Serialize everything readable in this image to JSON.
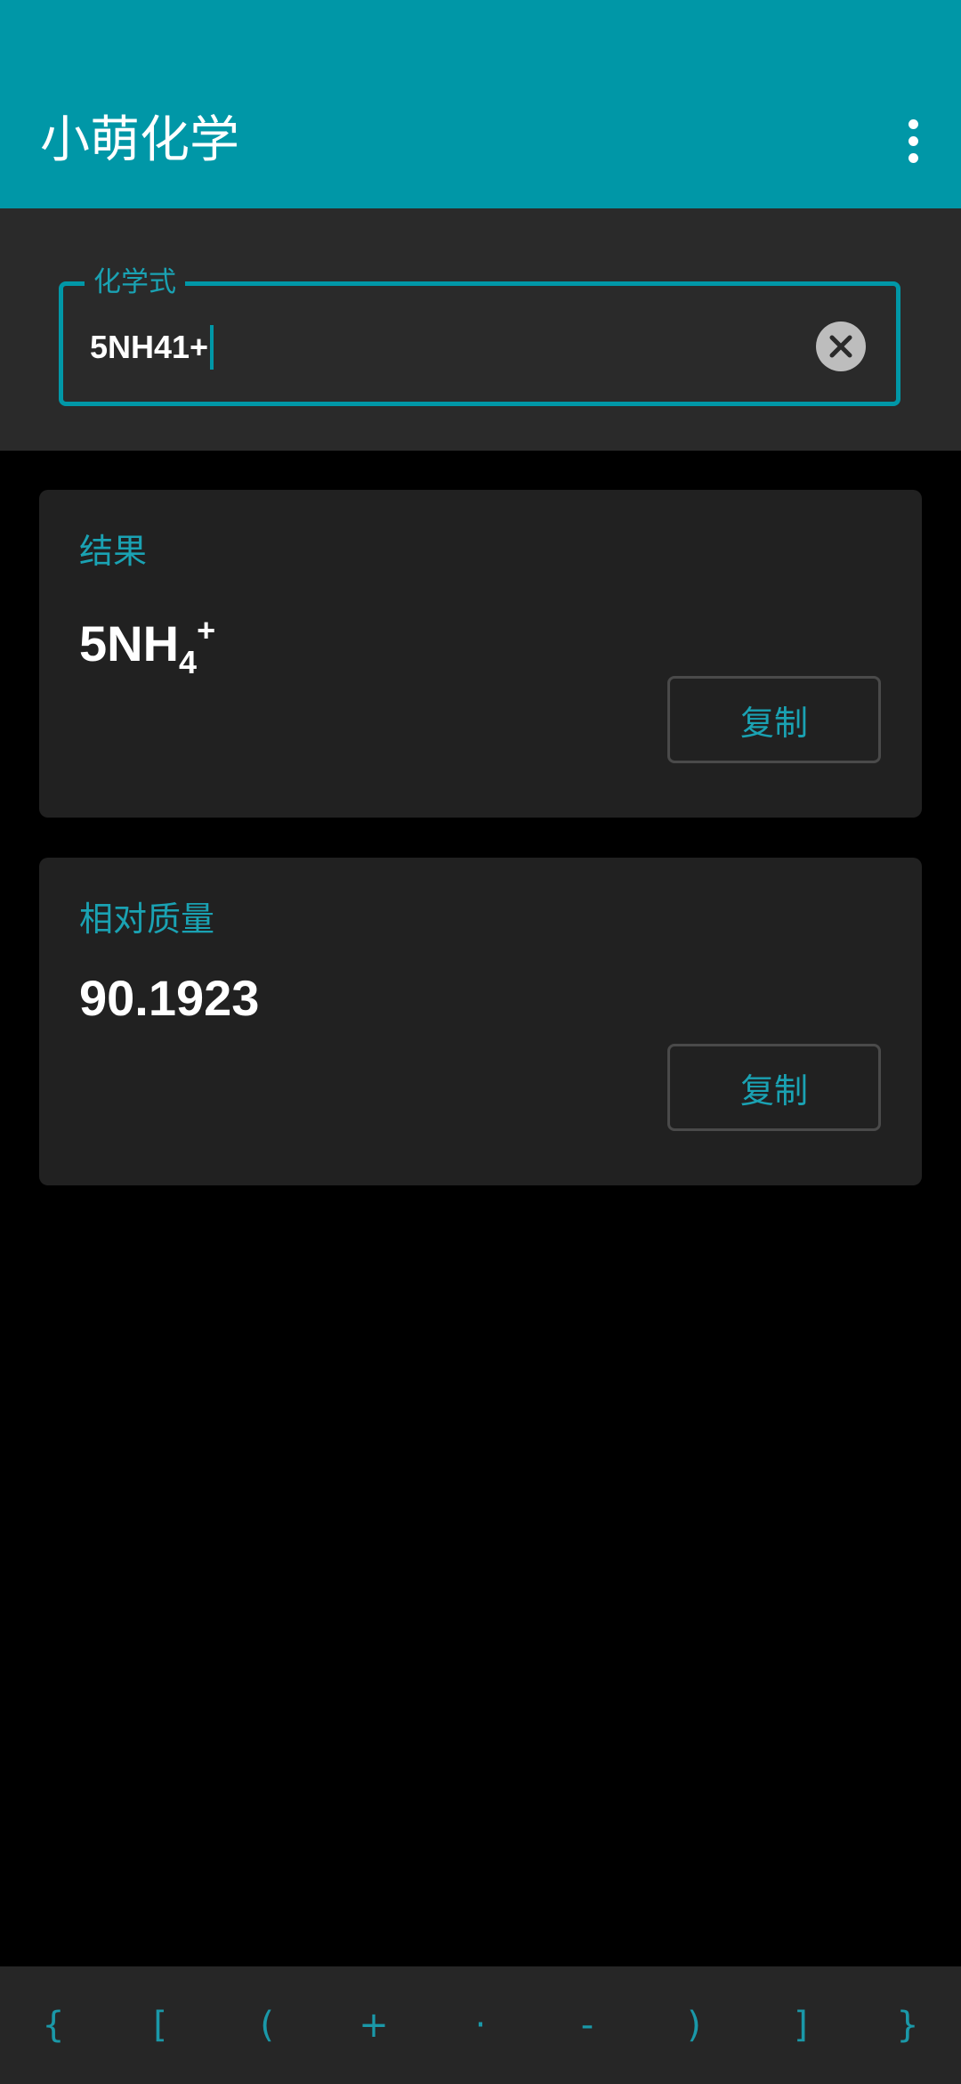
{
  "app": {
    "title": "小萌化学"
  },
  "input": {
    "label": "化学式",
    "value": "5NH41+"
  },
  "result_card": {
    "label": "结果",
    "value": {
      "prefix": "5NH",
      "subscript": "4",
      "superscript": "+"
    },
    "copy_label": "复制"
  },
  "mass_card": {
    "label": "相对质量",
    "value": "90.1923",
    "copy_label": "复制"
  },
  "symbols": [
    "{",
    "[",
    "(",
    "+",
    "·",
    "-",
    ")",
    "]",
    "}"
  ],
  "colors": {
    "accent": "#0097a7",
    "appbar": "#0097a7",
    "card": "#212121",
    "background": "#000000"
  },
  "icons": {
    "menu": "more-vert-icon",
    "clear": "clear-circle-icon"
  }
}
